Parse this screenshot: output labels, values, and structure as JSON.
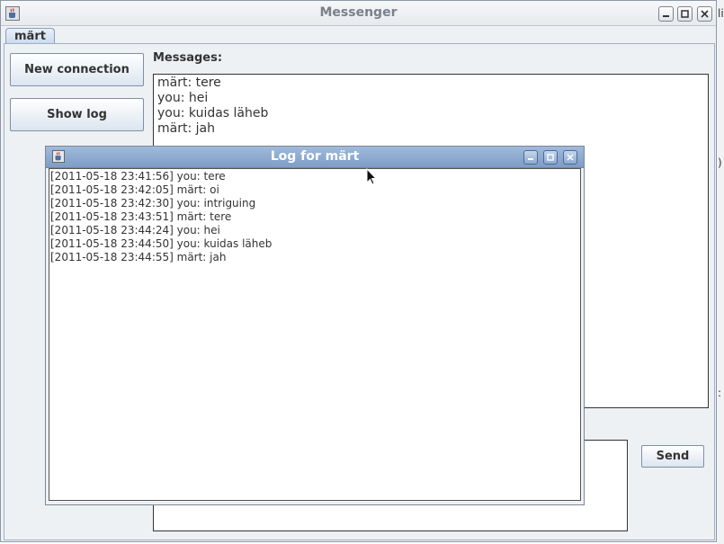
{
  "window": {
    "title": "Messenger",
    "icon": "java-cup-icon"
  },
  "tabs": [
    {
      "label": "märt",
      "selected": true
    }
  ],
  "sidebar": {
    "new_connection_label": "New connection",
    "show_log_label": "Show log"
  },
  "messages": {
    "label": "Messages:",
    "lines": [
      "märt: tere",
      "you: hei",
      "you: kuidas läheb",
      "märt: jah"
    ]
  },
  "compose": {
    "value": "",
    "send_label": "Send"
  },
  "log_window": {
    "title": "Log for märt",
    "entries": [
      "[2011-05-18 23:41:56] you: tere",
      "[2011-05-18 23:42:05] märt: oi",
      "[2011-05-18 23:42:30] you: intriguing",
      "[2011-05-18 23:43:51] märt: tere",
      "[2011-05-18 23:44:24] you: hei",
      "[2011-05-18 23:44:50] you: kuidas läheb",
      "[2011-05-18 23:44:55] märt: jah"
    ]
  },
  "colors": {
    "accent_title": "#8fadd3",
    "panel_bg": "#eef1f4"
  }
}
